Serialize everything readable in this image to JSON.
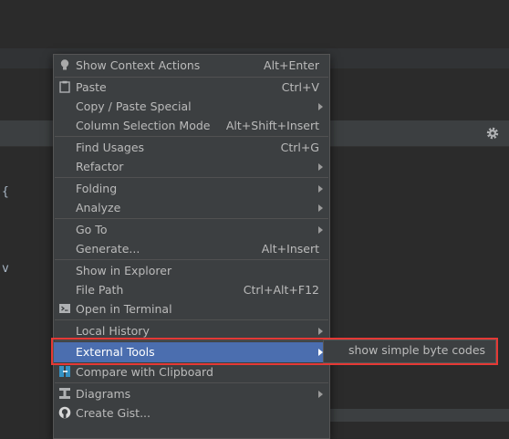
{
  "editor": {
    "line_chars": [
      "{",
      "v"
    ]
  },
  "context_menu": {
    "show_context_actions": {
      "label": "Show Context Actions",
      "shortcut": "Alt+Enter",
      "icon": "lightbulb-icon"
    },
    "paste": {
      "label": "Paste",
      "shortcut": "Ctrl+V",
      "icon": "clipboard-icon"
    },
    "copy_paste_special": {
      "label": "Copy / Paste Special"
    },
    "column_selection_mode": {
      "label": "Column Selection Mode",
      "shortcut": "Alt+Shift+Insert"
    },
    "find_usages": {
      "label": "Find Usages",
      "shortcut": "Ctrl+G"
    },
    "refactor": {
      "label": "Refactor"
    },
    "folding": {
      "label": "Folding"
    },
    "analyze": {
      "label": "Analyze"
    },
    "go_to": {
      "label": "Go To"
    },
    "generate": {
      "label": "Generate...",
      "shortcut": "Alt+Insert"
    },
    "show_in_explorer": {
      "label": "Show in Explorer"
    },
    "file_path": {
      "label": "File Path",
      "shortcut": "Ctrl+Alt+F12"
    },
    "open_in_terminal": {
      "label": "Open in Terminal",
      "icon": "terminal-icon"
    },
    "local_history": {
      "label": "Local History"
    },
    "external_tools": {
      "label": "External Tools",
      "selected": true
    },
    "compare_with_clipboard": {
      "label": "Compare with Clipboard",
      "icon": "compare-icon"
    },
    "diagrams": {
      "label": "Diagrams",
      "icon": "diagram-icon"
    },
    "create_gist": {
      "label": "Create Gist...",
      "icon": "github-icon"
    }
  },
  "submenu": {
    "items": [
      {
        "label": "show simple byte codes"
      }
    ]
  },
  "colors": {
    "menu_bg": "#3c3f41",
    "selected_bg": "#4b6eaf",
    "highlight_border": "#e53935",
    "editor_bg": "#2b2b2b"
  }
}
